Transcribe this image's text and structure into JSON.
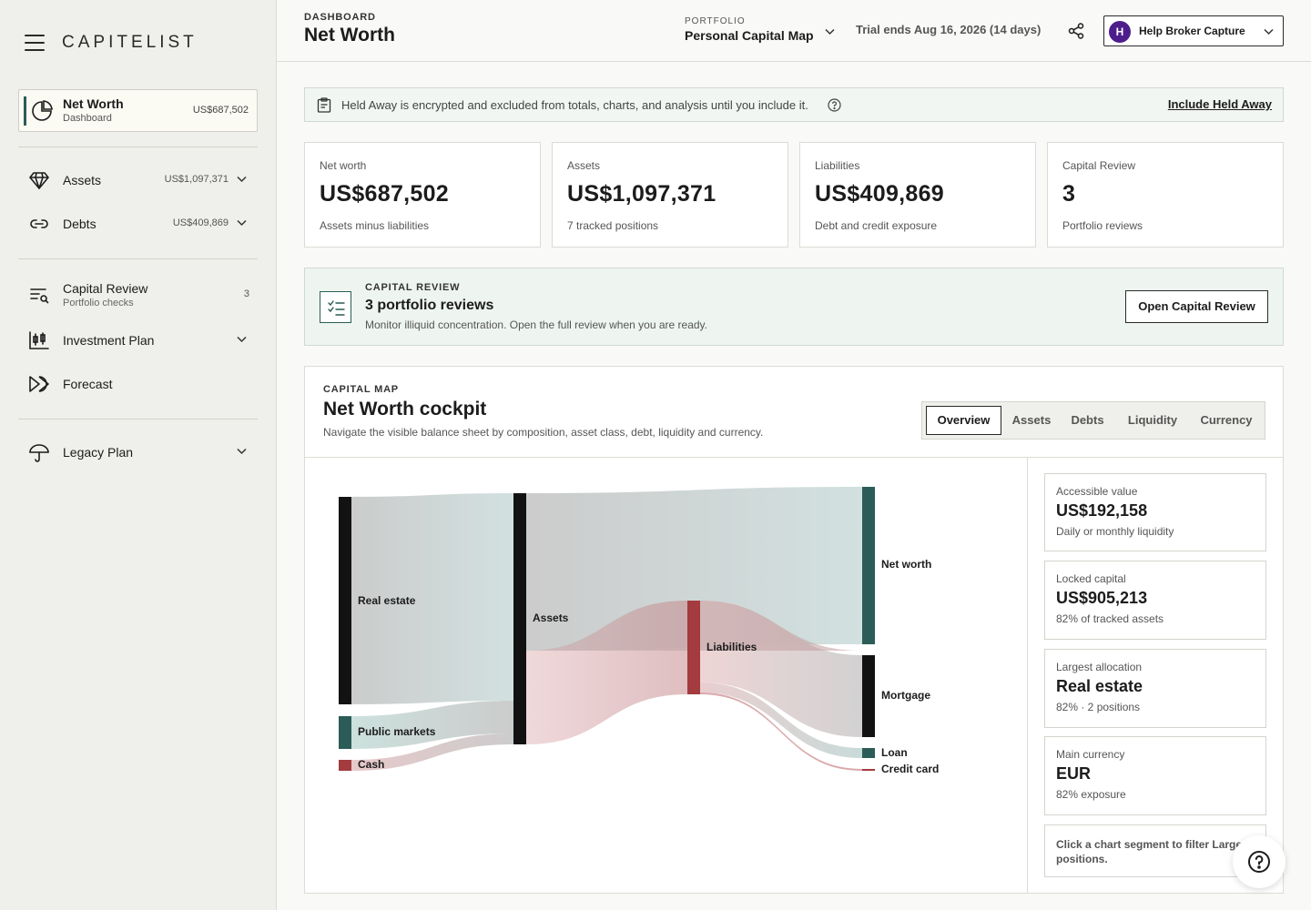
{
  "sidebar": {
    "brand": "CAPITELIST",
    "active": {
      "title": "Net Worth",
      "subtitle": "Dashboard",
      "value": "US$687,502"
    },
    "items": [
      {
        "label": "Assets",
        "value": "US$1,097,371"
      },
      {
        "label": "Debts",
        "value": "US$409,869"
      },
      {
        "label": "Capital Review",
        "subtitle": "Portfolio checks",
        "count": "3"
      },
      {
        "label": "Investment Plan"
      },
      {
        "label": "Forecast"
      },
      {
        "label": "Legacy Plan"
      }
    ]
  },
  "header": {
    "eyebrow": "DASHBOARD",
    "title": "Net Worth",
    "portfolio_label": "PORTFOLIO",
    "portfolio_name": "Personal Capital Map",
    "trial": "Trial ends Aug 16, 2026 (14 days)",
    "user_initial": "H",
    "user_name": "Help Broker Capture"
  },
  "notice": {
    "text": "Held Away is encrypted and excluded from totals, charts, and analysis until you include it.",
    "link": "Include Held Away"
  },
  "kpis": [
    {
      "label": "Net worth",
      "value": "US$687,502",
      "sub": "Assets minus liabilities"
    },
    {
      "label": "Assets",
      "value": "US$1,097,371",
      "sub": "7 tracked positions"
    },
    {
      "label": "Liabilities",
      "value": "US$409,869",
      "sub": "Debt and credit exposure"
    },
    {
      "label": "Capital Review",
      "value": "3",
      "sub": "Portfolio reviews"
    }
  ],
  "review": {
    "eyebrow": "CAPITAL REVIEW",
    "title": "3 portfolio reviews",
    "desc": "Monitor illiquid concentration. Open the full review when you are ready.",
    "button": "Open Capital Review"
  },
  "map": {
    "eyebrow": "CAPITAL MAP",
    "title": "Net Worth cockpit",
    "desc": "Navigate the visible balance sheet by composition, asset class, debt, liquidity and currency.",
    "tabs": [
      "Overview",
      "Assets",
      "Debts",
      "Liquidity",
      "Currency"
    ],
    "active_tab": "Overview"
  },
  "chart_data": {
    "type": "sankey",
    "nodes": [
      "Real estate",
      "Public markets",
      "Cash",
      "Assets",
      "Liabilities",
      "Net worth",
      "Mortgage",
      "Loan",
      "Credit card"
    ],
    "links": [
      {
        "source": "Real estate",
        "target": "Assets"
      },
      {
        "source": "Public markets",
        "target": "Assets"
      },
      {
        "source": "Cash",
        "target": "Assets"
      },
      {
        "source": "Assets",
        "target": "Net worth"
      },
      {
        "source": "Assets",
        "target": "Liabilities"
      },
      {
        "source": "Liabilities",
        "target": "Mortgage"
      },
      {
        "source": "Liabilities",
        "target": "Loan"
      },
      {
        "source": "Liabilities",
        "target": "Credit card"
      }
    ],
    "colors": {
      "dark": "#121212",
      "teal": "#2c5c57",
      "red": "#a33b3f"
    }
  },
  "side": [
    {
      "label": "Accessible value",
      "value": "US$192,158",
      "sub": "Daily or monthly liquidity"
    },
    {
      "label": "Locked capital",
      "value": "US$905,213",
      "sub": "82% of tracked assets"
    },
    {
      "label": "Largest allocation",
      "value": "Real estate",
      "sub": "82% · 2 positions"
    },
    {
      "label": "Main currency",
      "value": "EUR",
      "sub": "82% exposure"
    }
  ],
  "side_note": "Click a chart segment to filter Largest positions."
}
